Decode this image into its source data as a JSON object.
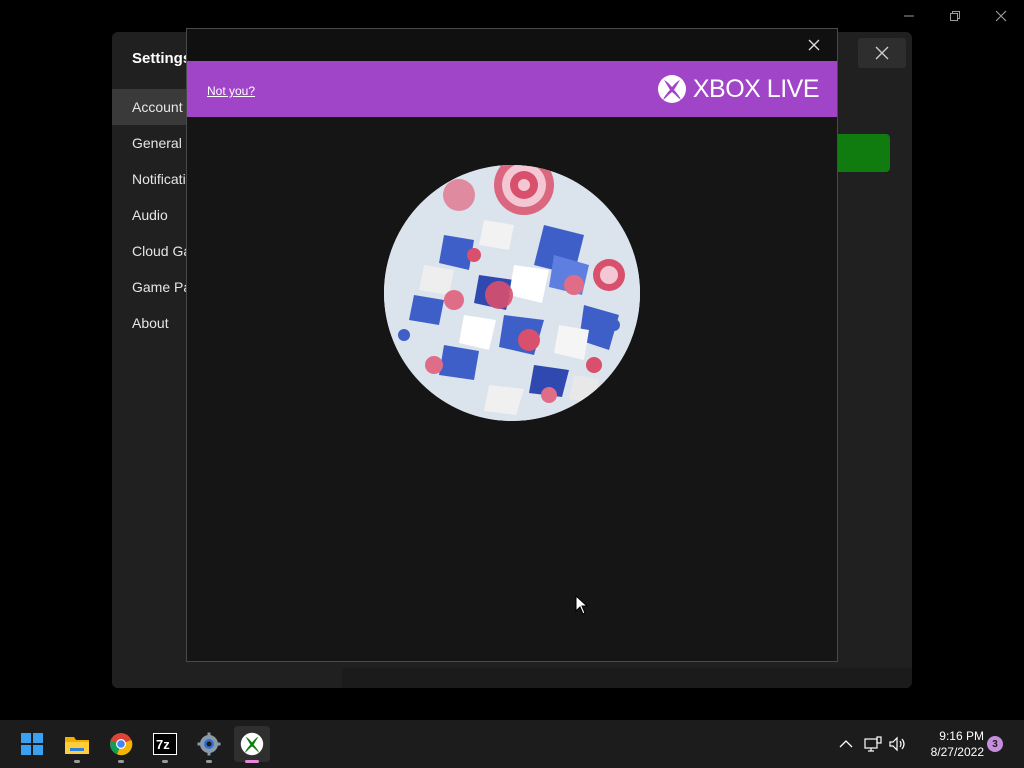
{
  "window": {
    "controls": {
      "minimize_icon": "minimize-icon",
      "restore_icon": "restore-icon",
      "close_icon": "close-icon"
    }
  },
  "settings": {
    "title": "Settings",
    "nav_items": [
      {
        "label": "Account",
        "active": true
      },
      {
        "label": "General",
        "active": false
      },
      {
        "label": "Notificati",
        "active": false
      },
      {
        "label": "Audio",
        "active": false
      },
      {
        "label": "Cloud Ga",
        "active": false
      },
      {
        "label": "Game Pa",
        "active": false
      },
      {
        "label": "About",
        "active": false
      }
    ],
    "accent_color": "#107c10"
  },
  "dialog": {
    "banner_color": "#a044c8",
    "not_you_link": "Not you?",
    "brand_text": "XBOX LIVE",
    "avatar_icon": "gamerpic-avatar"
  },
  "taskbar": {
    "apps": [
      {
        "name": "start-icon",
        "open": false
      },
      {
        "name": "file-explorer-icon",
        "open": true
      },
      {
        "name": "chrome-icon",
        "open": true
      },
      {
        "name": "7zip-icon",
        "open": true
      },
      {
        "name": "settings-gear-icon",
        "open": true
      },
      {
        "name": "xbox-icon",
        "open": true,
        "active": true
      }
    ],
    "tray_icons": [
      "chevron-up-icon",
      "network-icon",
      "volume-icon"
    ],
    "time": "9:16 PM",
    "date": "8/27/2022",
    "notification_count": "3"
  }
}
